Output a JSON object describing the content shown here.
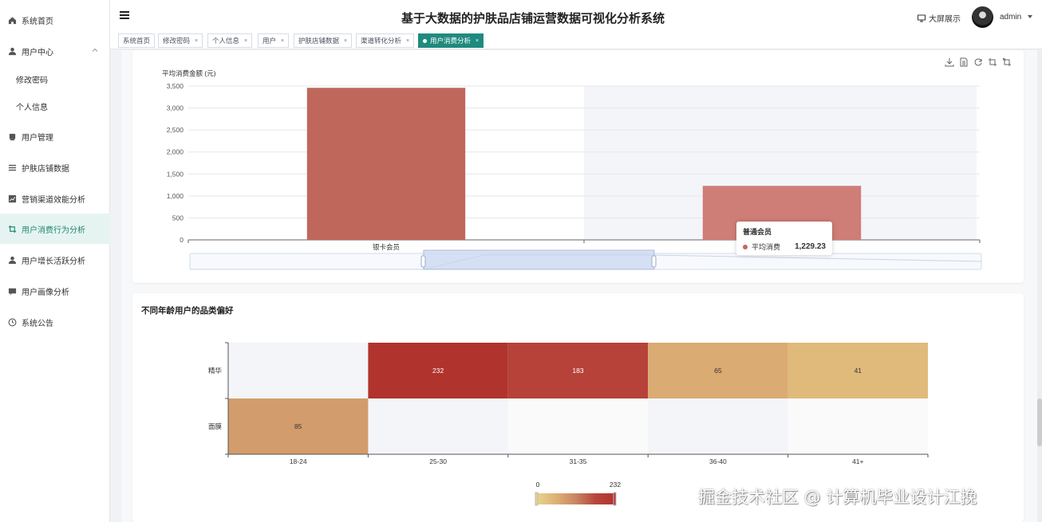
{
  "app": {
    "title": "基于大数据的护肤品店铺运营数据可视化分析系统",
    "big_screen_label": "大屏展示",
    "username": "admin"
  },
  "sidebar": {
    "items": [
      {
        "label": "系统首页",
        "icon": "home-icon"
      },
      {
        "label": "用户中心",
        "icon": "user-icon"
      },
      {
        "label": "修改密码",
        "icon": ""
      },
      {
        "label": "个人信息",
        "icon": ""
      },
      {
        "label": "用户管理",
        "icon": "database-icon"
      },
      {
        "label": "护肤店铺数据",
        "icon": "list-icon"
      },
      {
        "label": "营销渠道效能分析",
        "icon": "chart-icon"
      },
      {
        "label": "用户消费行为分析",
        "icon": "crop-icon"
      },
      {
        "label": "用户增长活跃分析",
        "icon": "user-icon"
      },
      {
        "label": "用户画像分析",
        "icon": "message-icon"
      },
      {
        "label": "系统公告",
        "icon": "clock-icon"
      }
    ],
    "active_index": 7
  },
  "tabs": [
    {
      "label": "系统首页",
      "closable": false
    },
    {
      "label": "修改密码",
      "closable": true
    },
    {
      "label": "个人信息",
      "closable": true
    },
    {
      "label": "用户",
      "closable": true
    },
    {
      "label": "护肤店铺数据",
      "closable": true
    },
    {
      "label": "渠道转化分析",
      "closable": true
    },
    {
      "label": "用户消费分析",
      "closable": true,
      "active": true
    }
  ],
  "tab_close_glyph": "×",
  "chart_data": [
    {
      "type": "bar",
      "ylabel": "平均消费金额 (元)",
      "categories": [
        "银卡会员",
        "普通会员"
      ],
      "series": [
        {
          "name": "平均消费",
          "values": [
            3460,
            1229.23
          ]
        }
      ],
      "ylim": [
        0,
        3500
      ],
      "yticks": [
        "0",
        "500",
        "1,000",
        "1,500",
        "2,000",
        "2,500",
        "3,000",
        "3,500"
      ],
      "color": "#c0675c",
      "highlight_color": "#cf7d77",
      "tooltip": {
        "category": "普通会员",
        "series": "平均消费",
        "value": "1,229.23"
      },
      "grid": true
    },
    {
      "type": "heatmap",
      "title": "不同年龄用户的品类偏好",
      "x": [
        "18-24",
        "25-30",
        "31-35",
        "36-40",
        "41+"
      ],
      "y": [
        "精华",
        "面膜"
      ],
      "values": [
        {
          "x": "25-30",
          "y": "精华",
          "value": 232
        },
        {
          "x": "31-35",
          "y": "精华",
          "value": 183
        },
        {
          "x": "36-40",
          "y": "精华",
          "value": 65
        },
        {
          "x": "41+",
          "y": "精华",
          "value": 41
        },
        {
          "x": "18-24",
          "y": "面膜",
          "value": 85
        }
      ],
      "visual_map": {
        "min": 0,
        "max": 232,
        "min_label": "0",
        "max_label": "232",
        "colors": [
          "#e9d28a",
          "#dcb074",
          "#c98562",
          "#b7453b",
          "#b1332d"
        ]
      }
    }
  ],
  "watermark": "掘金技术社区 @ 计算机毕业设计江挽"
}
